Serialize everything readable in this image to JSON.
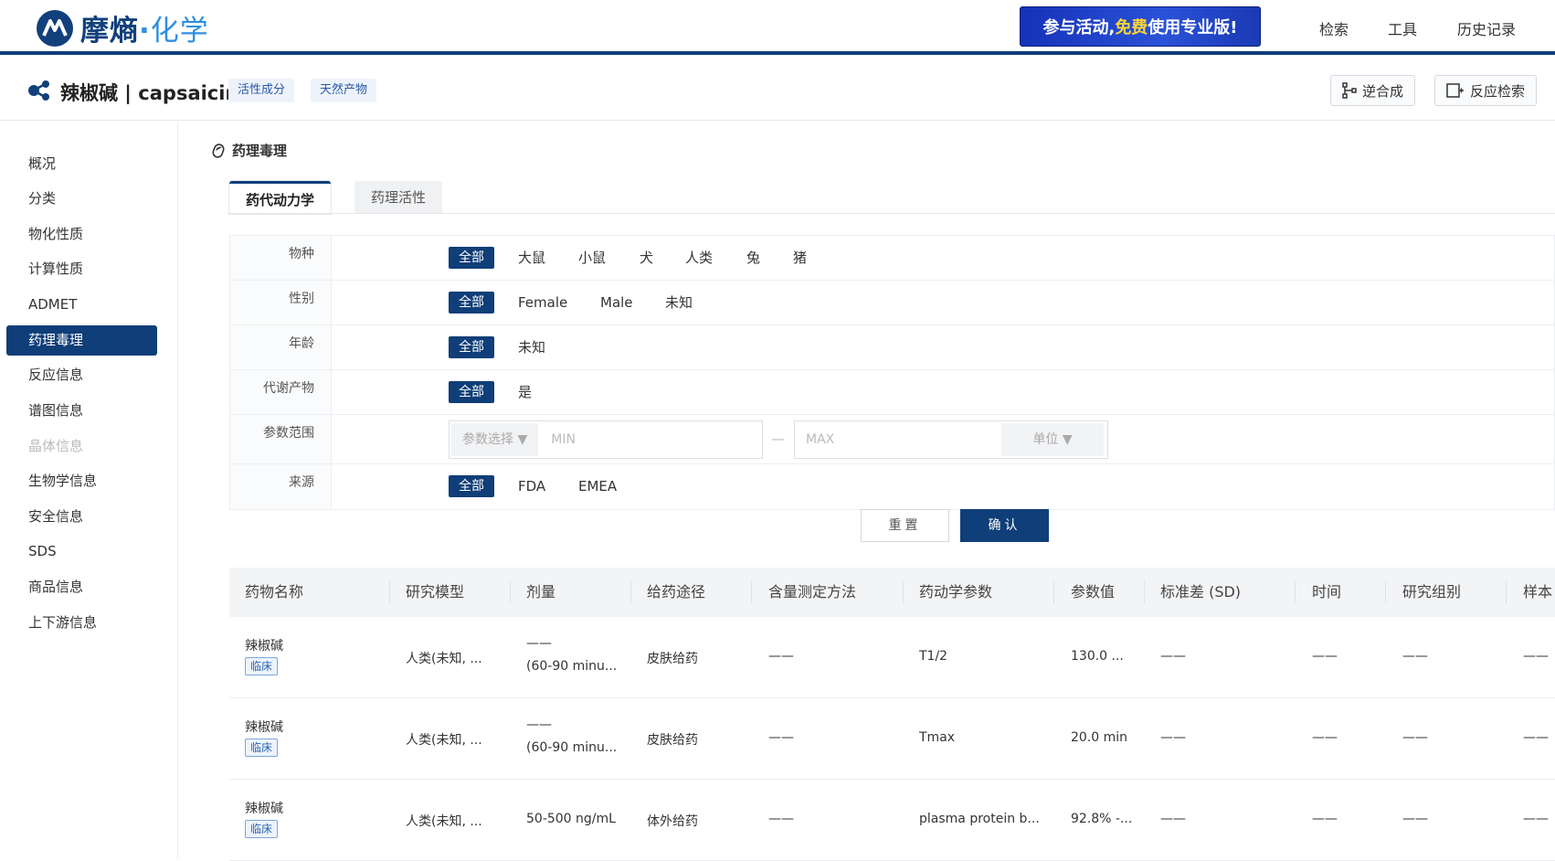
{
  "brand": {
    "name_main": "摩熵",
    "name_dot": "·",
    "name_sub": "化学"
  },
  "promo": {
    "text_a": "参与活动,",
    "text_hl": "免费",
    "text_b": "使用专业版!"
  },
  "topnav": [
    "检索",
    "工具",
    "历史记录"
  ],
  "compound": {
    "name": "辣椒碱 | capsaicin",
    "tags": [
      "活性成分",
      "天然产物"
    ]
  },
  "actions": {
    "retro": "逆合成",
    "reaction": "反应检索"
  },
  "sidebar": {
    "items": [
      "概况",
      "分类",
      "物化性质",
      "计算性质",
      "ADMET",
      "药理毒理",
      "反应信息",
      "谱图信息",
      "晶体信息",
      "生物学信息",
      "安全信息",
      "SDS",
      "商品信息",
      "上下游信息"
    ],
    "active": "药理毒理",
    "disabled": "晶体信息"
  },
  "section": {
    "title": "药理毒理"
  },
  "tabs": [
    "药代动力学",
    "药理活性"
  ],
  "filters": {
    "species": {
      "label": "物种",
      "options": [
        "全部",
        "大鼠",
        "小鼠",
        "犬",
        "人类",
        "兔",
        "猪"
      ]
    },
    "gender": {
      "label": "性别",
      "options": [
        "全部",
        "Female",
        "Male",
        "未知"
      ]
    },
    "age": {
      "label": "年龄",
      "options": [
        "全部",
        "未知"
      ]
    },
    "metabolite": {
      "label": "代谢产物",
      "options": [
        "全部",
        "是"
      ]
    },
    "range": {
      "label": "参数范围",
      "param_select": "参数选择",
      "min": "MIN",
      "dash": "—",
      "max": "MAX",
      "unit": "单位"
    },
    "source": {
      "label": "来源",
      "options": [
        "全部",
        "FDA",
        "EMEA"
      ]
    }
  },
  "buttons": {
    "reset": "重置",
    "confirm": "确认"
  },
  "table": {
    "headers": [
      "药物名称",
      "研究模型",
      "剂量",
      "给药途径",
      "含量测定方法",
      "药动学参数",
      "参数值",
      "标准差 (SD)",
      "时间",
      "研究组别",
      "样本"
    ],
    "rows": [
      {
        "name": "辣椒碱",
        "badge": "临床",
        "model": "人类(未知, ...",
        "dose1": "——",
        "dose2": "(60-90 minu...",
        "route": "皮肤给药",
        "method": "——",
        "param": "T1/2",
        "value": "130.0 ...",
        "sd": "——",
        "time": "——",
        "group": "——",
        "sample": "——"
      },
      {
        "name": "辣椒碱",
        "badge": "临床",
        "model": "人类(未知, ...",
        "dose1": "——",
        "dose2": "(60-90 minu...",
        "route": "皮肤给药",
        "method": "——",
        "param": "Tmax",
        "value": "20.0 min",
        "sd": "——",
        "time": "——",
        "group": "——",
        "sample": "——"
      },
      {
        "name": "辣椒碱",
        "badge": "临床",
        "model": "人类(未知, ...",
        "dose1": "",
        "dose2": "50-500 ng/mL",
        "route": "体外给药",
        "method": "——",
        "param": "plasma protein b...",
        "value": "92.8% -...",
        "sd": "——",
        "time": "——",
        "group": "——",
        "sample": "——"
      }
    ]
  }
}
